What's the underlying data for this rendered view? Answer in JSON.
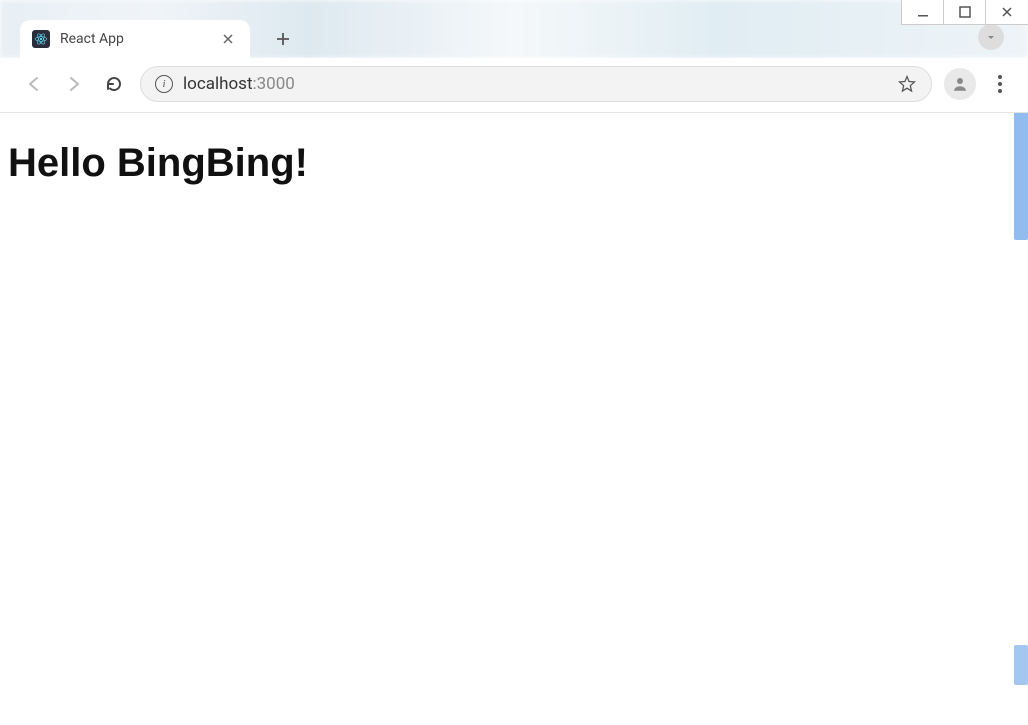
{
  "window": {
    "controls": {
      "minimize": "−",
      "maximize": "▢",
      "close": "✕"
    }
  },
  "tab": {
    "title": "React App",
    "favicon_label": "react-logo"
  },
  "toolbar": {
    "url_main": "localhost",
    "url_port": ":3000",
    "info_icon": "i"
  },
  "page": {
    "heading": "Hello BingBing!"
  }
}
